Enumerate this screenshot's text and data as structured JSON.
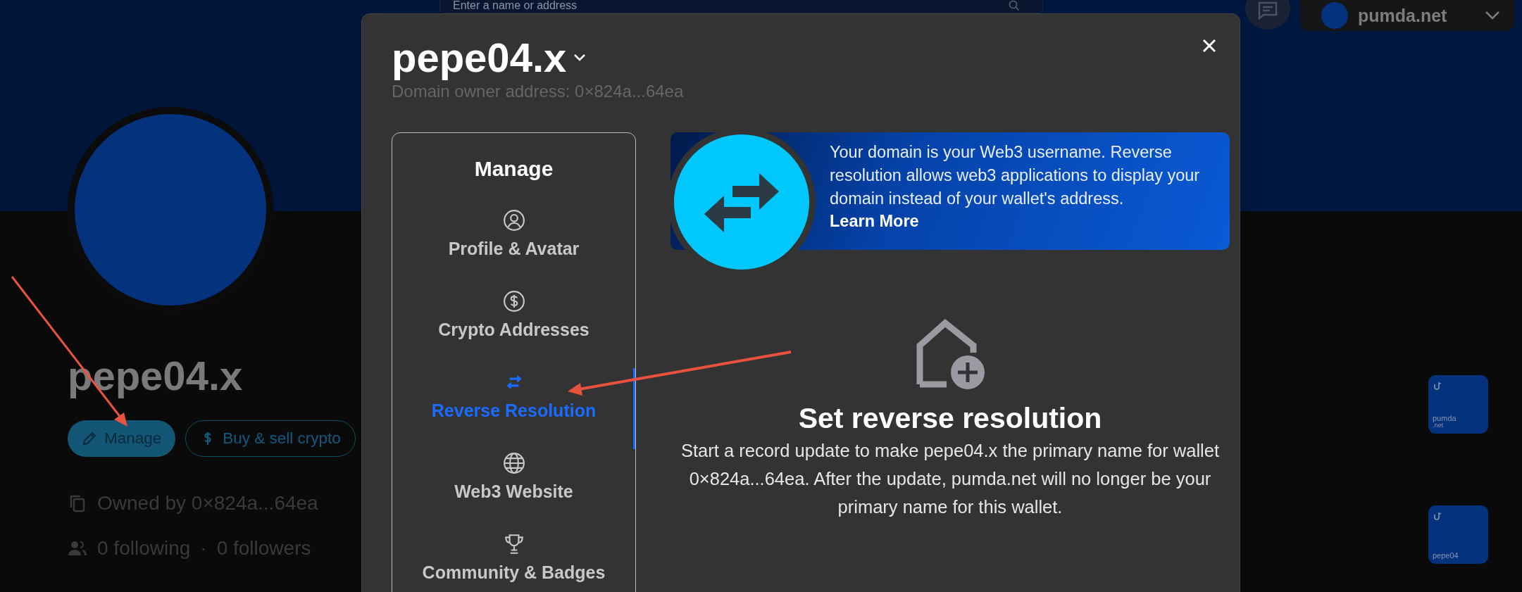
{
  "header": {
    "search": {
      "placeholder": "Enter a name or address"
    },
    "account": {
      "name": "pumda.net"
    }
  },
  "profile": {
    "name": "pepe04.x",
    "buttons": [
      {
        "label": "Manage",
        "kind": "primary"
      },
      {
        "label": "Buy & sell crypto",
        "kind": "outline"
      }
    ],
    "owner": "Owned by 0×824a...64ea",
    "following": "0 following",
    "separator": "·",
    "followers": "0 followers"
  },
  "domain_cards": [
    {
      "name": "pumda",
      "tld": ".net"
    },
    {
      "name": "pepe04"
    }
  ],
  "modal": {
    "title": "pepe04.x",
    "subtitle": "Domain owner address: 0×824a...64ea",
    "sidebar": {
      "heading": "Manage",
      "items": [
        {
          "label": "Profile & Avatar",
          "selected": false
        },
        {
          "label": "Crypto Addresses",
          "selected": false
        },
        {
          "label": "Reverse Resolution",
          "selected": true
        },
        {
          "label": "Web3 Website",
          "selected": false
        },
        {
          "label": "Community & Badges",
          "selected": false
        }
      ]
    },
    "banner": {
      "text": "Your domain is your Web3 username. Reverse resolution allows web3 applications to display your domain instead of your wallet's address.",
      "link": "Learn More"
    },
    "empty_state": {
      "title": "Set reverse resolution",
      "text": "Start a record update to make pepe04.x the primary name for wallet 0×824a...64ea. After the update, pumda.net will no longer be your primary name for this wallet."
    }
  }
}
